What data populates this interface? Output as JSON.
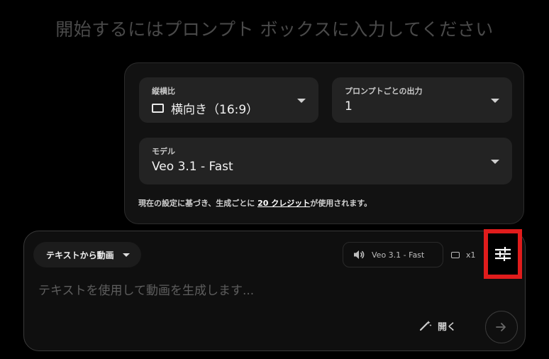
{
  "heading": "開始するにはプロンプト ボックスに入力してください",
  "settings": {
    "aspect_ratio": {
      "label": "縦横比",
      "value": "横向き（16:9）"
    },
    "outputs_per_prompt": {
      "label": "プロンプトごとの出力",
      "value": "1"
    },
    "model": {
      "label": "モデル",
      "value": "Veo 3.1 - Fast"
    },
    "credit_note": {
      "prefix": "現在の設定に基づき、生成ごとに ",
      "link": "20 クレジット",
      "suffix": "が使用されます。"
    }
  },
  "composer": {
    "mode_label": "テキストから動画",
    "model_chip": "Veo 3.1 - Fast",
    "count_chip": "x1",
    "prompt_placeholder": "テキストを使用して動画を生成します...",
    "expand_label": "開く"
  },
  "icons": {
    "aspect": "rectangle-icon",
    "audio": "speaker-icon",
    "settings": "sliders-icon",
    "expand": "magic-wand-icon",
    "send": "arrow-right-icon"
  },
  "colors": {
    "highlight_border": "#e01c1c",
    "background": "#000000",
    "panel": "#121212",
    "field": "#232323"
  }
}
